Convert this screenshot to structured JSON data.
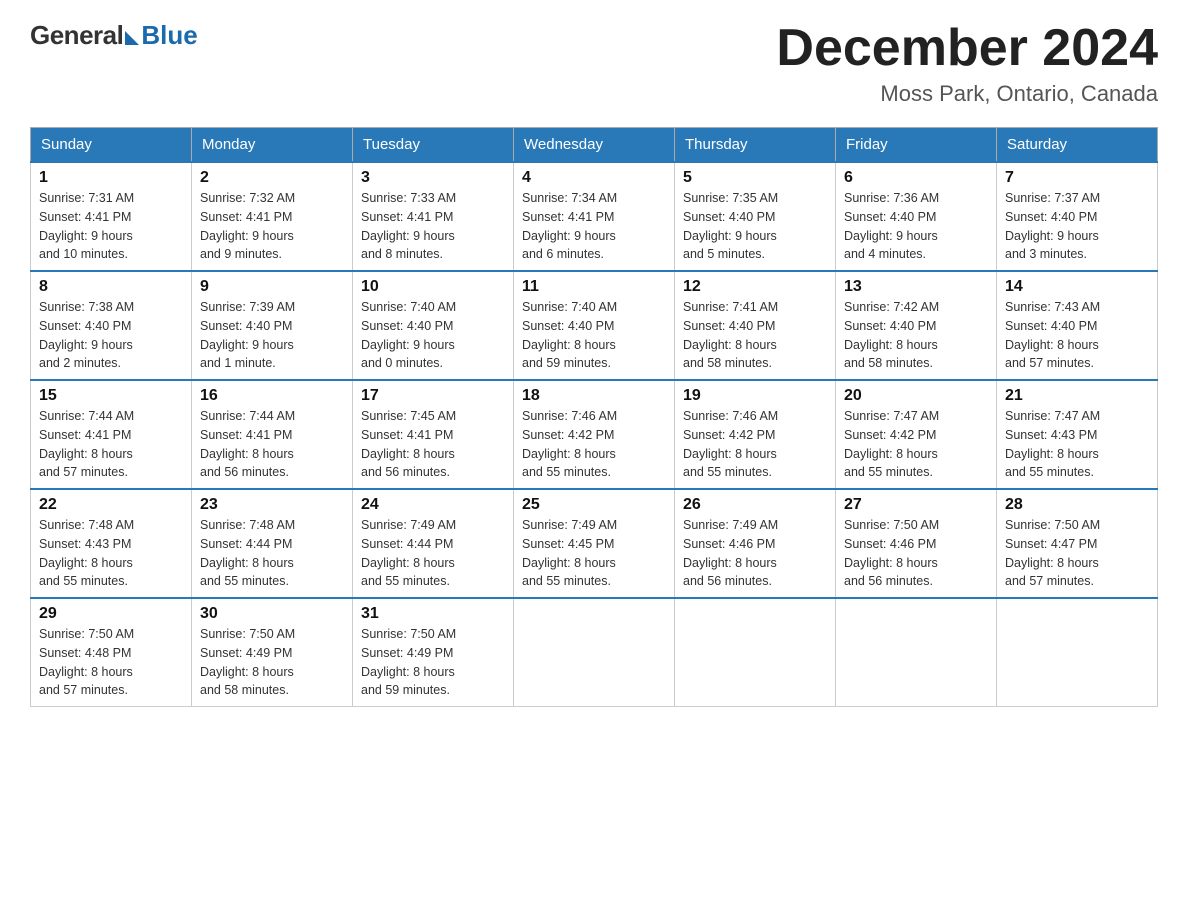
{
  "logo": {
    "general": "General",
    "blue": "Blue"
  },
  "header": {
    "month_year": "December 2024",
    "location": "Moss Park, Ontario, Canada"
  },
  "days_of_week": [
    "Sunday",
    "Monday",
    "Tuesday",
    "Wednesday",
    "Thursday",
    "Friday",
    "Saturday"
  ],
  "weeks": [
    [
      {
        "day": "1",
        "sunrise": "7:31 AM",
        "sunset": "4:41 PM",
        "daylight": "9 hours and 10 minutes."
      },
      {
        "day": "2",
        "sunrise": "7:32 AM",
        "sunset": "4:41 PM",
        "daylight": "9 hours and 9 minutes."
      },
      {
        "day": "3",
        "sunrise": "7:33 AM",
        "sunset": "4:41 PM",
        "daylight": "9 hours and 8 minutes."
      },
      {
        "day": "4",
        "sunrise": "7:34 AM",
        "sunset": "4:41 PM",
        "daylight": "9 hours and 6 minutes."
      },
      {
        "day": "5",
        "sunrise": "7:35 AM",
        "sunset": "4:40 PM",
        "daylight": "9 hours and 5 minutes."
      },
      {
        "day": "6",
        "sunrise": "7:36 AM",
        "sunset": "4:40 PM",
        "daylight": "9 hours and 4 minutes."
      },
      {
        "day": "7",
        "sunrise": "7:37 AM",
        "sunset": "4:40 PM",
        "daylight": "9 hours and 3 minutes."
      }
    ],
    [
      {
        "day": "8",
        "sunrise": "7:38 AM",
        "sunset": "4:40 PM",
        "daylight": "9 hours and 2 minutes."
      },
      {
        "day": "9",
        "sunrise": "7:39 AM",
        "sunset": "4:40 PM",
        "daylight": "9 hours and 1 minute."
      },
      {
        "day": "10",
        "sunrise": "7:40 AM",
        "sunset": "4:40 PM",
        "daylight": "9 hours and 0 minutes."
      },
      {
        "day": "11",
        "sunrise": "7:40 AM",
        "sunset": "4:40 PM",
        "daylight": "8 hours and 59 minutes."
      },
      {
        "day": "12",
        "sunrise": "7:41 AM",
        "sunset": "4:40 PM",
        "daylight": "8 hours and 58 minutes."
      },
      {
        "day": "13",
        "sunrise": "7:42 AM",
        "sunset": "4:40 PM",
        "daylight": "8 hours and 58 minutes."
      },
      {
        "day": "14",
        "sunrise": "7:43 AM",
        "sunset": "4:40 PM",
        "daylight": "8 hours and 57 minutes."
      }
    ],
    [
      {
        "day": "15",
        "sunrise": "7:44 AM",
        "sunset": "4:41 PM",
        "daylight": "8 hours and 57 minutes."
      },
      {
        "day": "16",
        "sunrise": "7:44 AM",
        "sunset": "4:41 PM",
        "daylight": "8 hours and 56 minutes."
      },
      {
        "day": "17",
        "sunrise": "7:45 AM",
        "sunset": "4:41 PM",
        "daylight": "8 hours and 56 minutes."
      },
      {
        "day": "18",
        "sunrise": "7:46 AM",
        "sunset": "4:42 PM",
        "daylight": "8 hours and 55 minutes."
      },
      {
        "day": "19",
        "sunrise": "7:46 AM",
        "sunset": "4:42 PM",
        "daylight": "8 hours and 55 minutes."
      },
      {
        "day": "20",
        "sunrise": "7:47 AM",
        "sunset": "4:42 PM",
        "daylight": "8 hours and 55 minutes."
      },
      {
        "day": "21",
        "sunrise": "7:47 AM",
        "sunset": "4:43 PM",
        "daylight": "8 hours and 55 minutes."
      }
    ],
    [
      {
        "day": "22",
        "sunrise": "7:48 AM",
        "sunset": "4:43 PM",
        "daylight": "8 hours and 55 minutes."
      },
      {
        "day": "23",
        "sunrise": "7:48 AM",
        "sunset": "4:44 PM",
        "daylight": "8 hours and 55 minutes."
      },
      {
        "day": "24",
        "sunrise": "7:49 AM",
        "sunset": "4:44 PM",
        "daylight": "8 hours and 55 minutes."
      },
      {
        "day": "25",
        "sunrise": "7:49 AM",
        "sunset": "4:45 PM",
        "daylight": "8 hours and 55 minutes."
      },
      {
        "day": "26",
        "sunrise": "7:49 AM",
        "sunset": "4:46 PM",
        "daylight": "8 hours and 56 minutes."
      },
      {
        "day": "27",
        "sunrise": "7:50 AM",
        "sunset": "4:46 PM",
        "daylight": "8 hours and 56 minutes."
      },
      {
        "day": "28",
        "sunrise": "7:50 AM",
        "sunset": "4:47 PM",
        "daylight": "8 hours and 57 minutes."
      }
    ],
    [
      {
        "day": "29",
        "sunrise": "7:50 AM",
        "sunset": "4:48 PM",
        "daylight": "8 hours and 57 minutes."
      },
      {
        "day": "30",
        "sunrise": "7:50 AM",
        "sunset": "4:49 PM",
        "daylight": "8 hours and 58 minutes."
      },
      {
        "day": "31",
        "sunrise": "7:50 AM",
        "sunset": "4:49 PM",
        "daylight": "8 hours and 59 minutes."
      },
      null,
      null,
      null,
      null
    ]
  ],
  "labels": {
    "sunrise": "Sunrise:",
    "sunset": "Sunset:",
    "daylight": "Daylight:"
  }
}
